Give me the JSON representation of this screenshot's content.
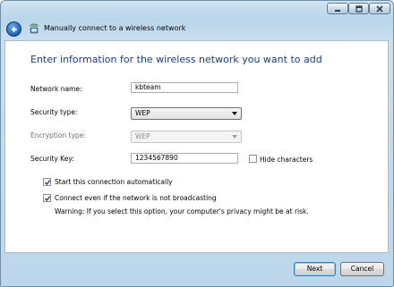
{
  "window": {
    "title": "Manually connect to a wireless network",
    "caption_buttons": {
      "minimize": "minimize-icon",
      "maximize": "maximize-icon",
      "close": "close-icon"
    }
  },
  "content": {
    "heading": "Enter information for the wireless network you want to add",
    "network_name": {
      "label": "Network name:",
      "value": "kbteam"
    },
    "security_type": {
      "label": "Security type:",
      "value": "WEP"
    },
    "encryption_type": {
      "label": "Encryption type:",
      "value": "WEP",
      "disabled": true
    },
    "security_key": {
      "label": "Security Key:",
      "value": "1234567890"
    },
    "hide_characters": {
      "label": "Hide characters",
      "checked": false
    },
    "start_auto": {
      "label": "Start this connection automatically",
      "checked": true
    },
    "connect_even": {
      "label": "Connect even if the network is not broadcasting",
      "checked": true
    },
    "warning": "Warning: If you select this option, your computer's privacy might be at risk."
  },
  "footer": {
    "next": "Next",
    "cancel": "Cancel"
  },
  "colors": {
    "heading": "#1b3a8c",
    "chrome": "#bcd6eb"
  }
}
